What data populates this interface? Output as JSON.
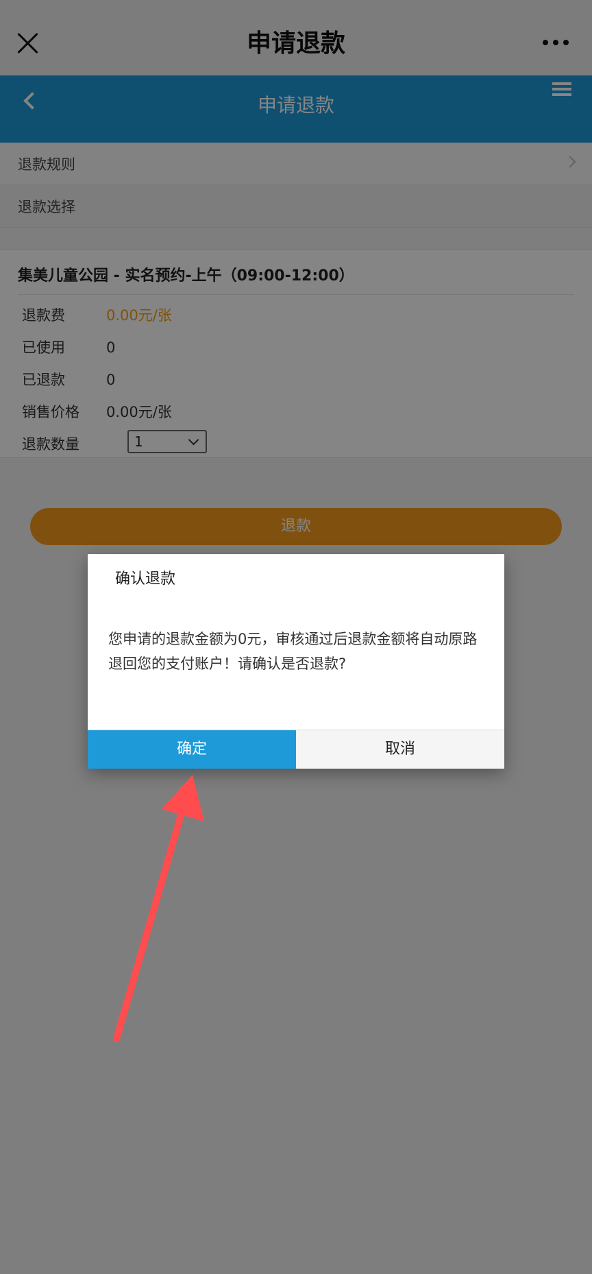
{
  "wechat_bar": {
    "title": "申请退款"
  },
  "header": {
    "title": "申请退款"
  },
  "sections": {
    "rules_label": "退款规则",
    "choice_label": "退款选择"
  },
  "ticket": {
    "title": "集美儿童公园 - 实名预约-上午（09:00-12:00）",
    "rows": [
      {
        "label": "退款费",
        "value": "0.00元/张"
      },
      {
        "label": "已使用",
        "value": "0"
      },
      {
        "label": "已退款",
        "value": "0"
      },
      {
        "label": "销售价格",
        "value": "0.00元/张"
      }
    ],
    "quantity_label": "退款数量",
    "quantity_value": "1"
  },
  "refund_button": "退款",
  "dialog": {
    "title": "确认退款",
    "message": "您申请的退款金额为0元，审核通过后退款金额将自动原路退回您的支付账户！请确认是否退款?",
    "ok_label": "确定",
    "cancel_label": "取消"
  },
  "colors": {
    "primary": "#1e9ad9",
    "accent_orange": "#f59b1b",
    "annotation_arrow": "#ff4d4f"
  }
}
